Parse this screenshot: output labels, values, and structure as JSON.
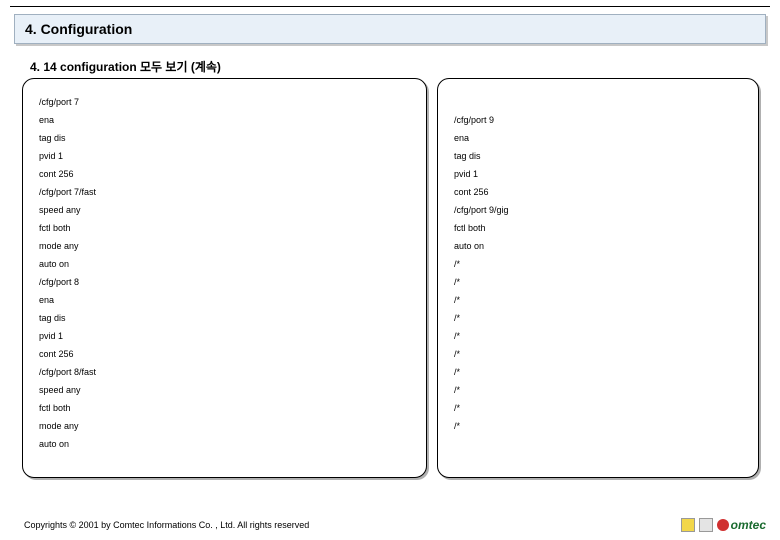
{
  "header": {
    "title": "4. Configuration"
  },
  "subtitle": "4. 14 configuration 모두 보기 (계속)",
  "panels": {
    "left": [
      "/cfg/port 7",
      "ena",
      "tag dis",
      "pvid 1",
      "cont 256",
      "/cfg/port 7/fast",
      "speed any",
      "fctl both",
      "mode any",
      "auto on",
      "/cfg/port 8",
      "ena",
      "tag dis",
      "pvid 1",
      "cont 256",
      "/cfg/port 8/fast",
      "speed any",
      "fctl both",
      "mode any",
      "auto on"
    ],
    "right": [
      "/cfg/port 9",
      "ena",
      "tag dis",
      "pvid 1",
      "cont 256",
      "/cfg/port 9/gig",
      "fctl both",
      "auto on",
      "/*",
      "/*",
      "/*",
      "/*",
      "/*",
      "/*",
      "/*",
      "/*",
      "/*",
      "/*"
    ]
  },
  "footer": "Copyrights © 2001 by Comtec Informations Co. , Ltd. All rights reserved",
  "brand": "omtec"
}
